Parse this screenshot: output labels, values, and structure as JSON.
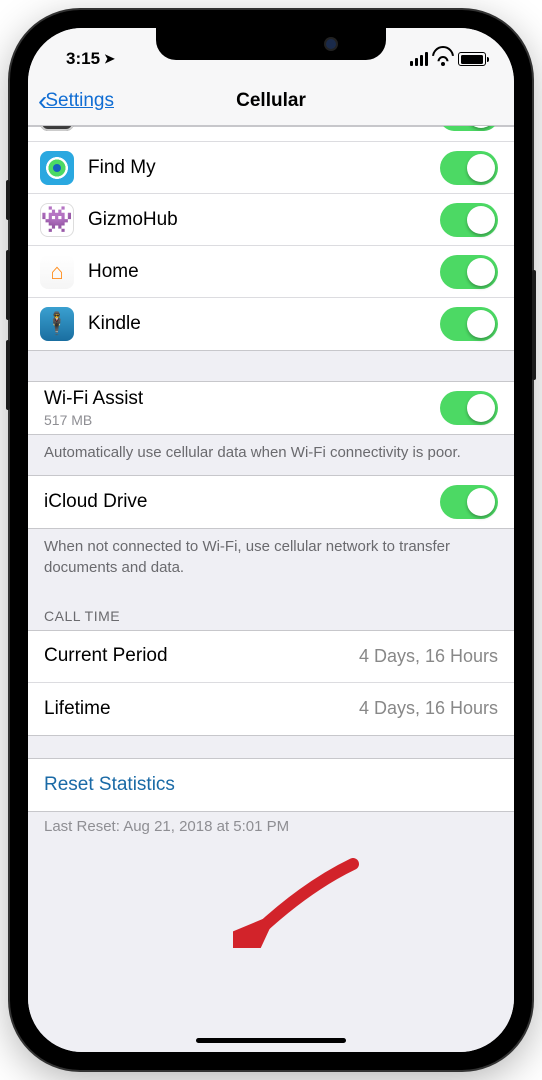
{
  "status": {
    "time": "3:15",
    "loc_glyph": "➤"
  },
  "nav": {
    "back": "Settings",
    "title": "Cellular"
  },
  "apps": [
    {
      "name": "Find My",
      "on": true,
      "id": "findmy"
    },
    {
      "name": "GizmoHub",
      "on": true,
      "id": "gizmo"
    },
    {
      "name": "Home",
      "on": true,
      "id": "home"
    },
    {
      "name": "Kindle",
      "on": true,
      "id": "kindle"
    }
  ],
  "wifi_assist": {
    "label": "Wi-Fi Assist",
    "sub": "517 MB",
    "on": true
  },
  "wifi_assist_footer": "Automatically use cellular data when Wi-Fi connectivity is poor.",
  "icloud_drive": {
    "label": "iCloud Drive",
    "on": true
  },
  "icloud_footer": "When not connected to Wi-Fi, use cellular network to transfer documents and data.",
  "call_time_header": "CALL TIME",
  "call_time": {
    "current_label": "Current Period",
    "current_value": "4 Days, 16 Hours",
    "lifetime_label": "Lifetime",
    "lifetime_value": "4 Days, 16 Hours"
  },
  "reset": "Reset Statistics",
  "last_reset": "Last Reset: Aug 21, 2018 at 5:01 PM"
}
